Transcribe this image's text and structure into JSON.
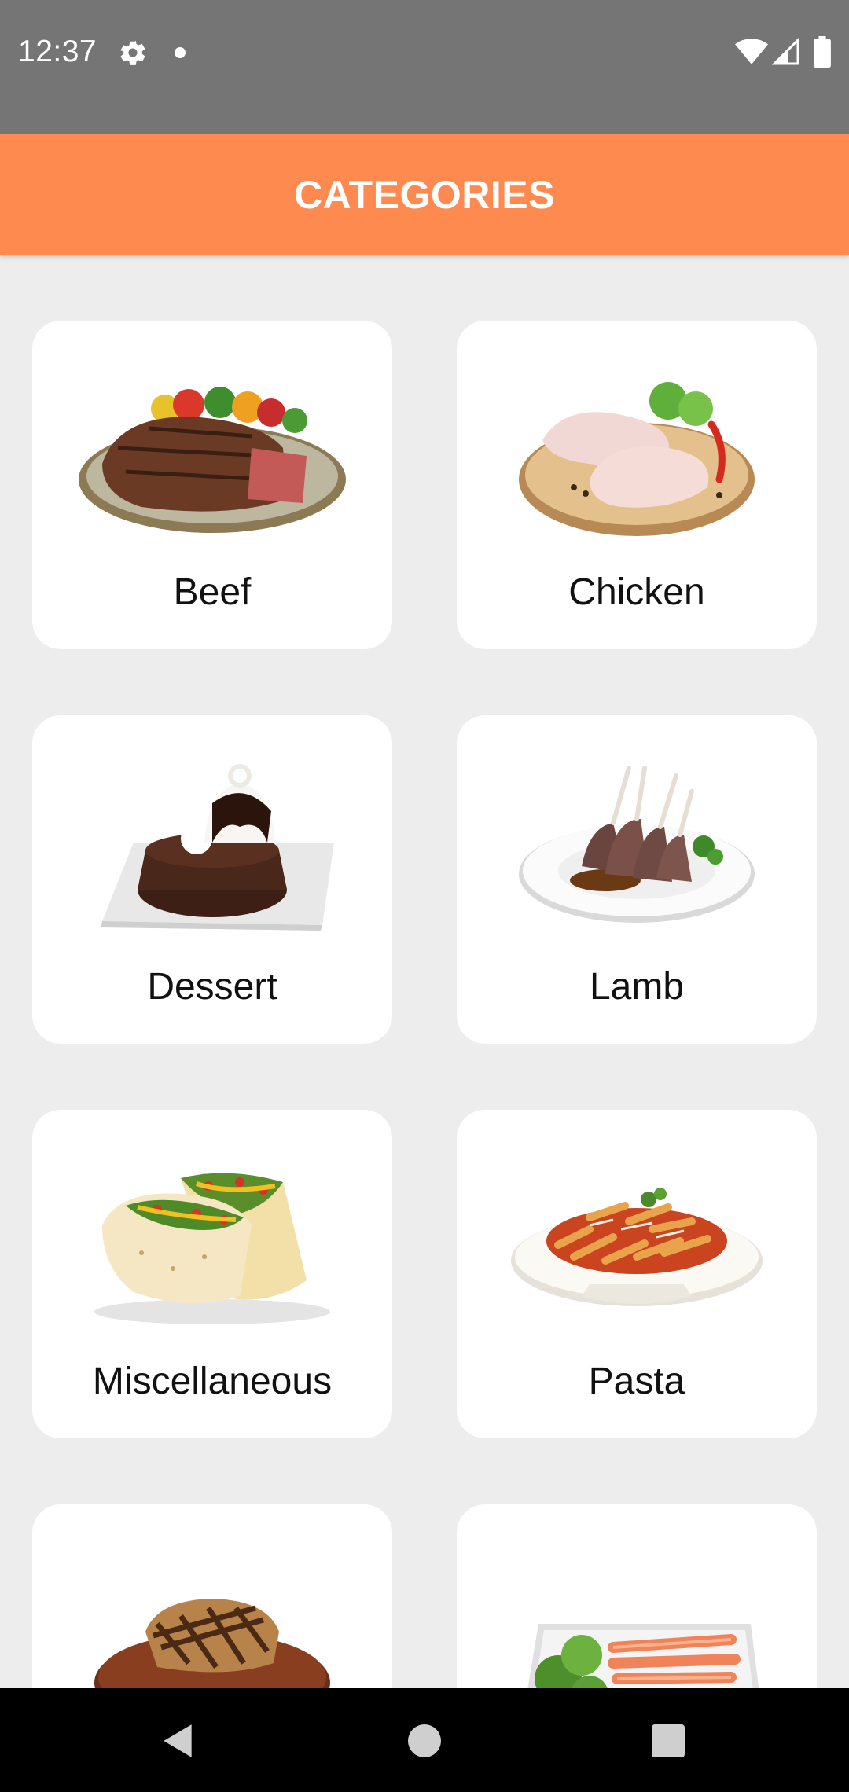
{
  "status_bar": {
    "time": "12:37",
    "icons": [
      "gear-icon",
      "notification-dot-icon",
      "wifi-icon",
      "signal-icon",
      "battery-icon"
    ]
  },
  "app_bar": {
    "title": "CATEGORIES",
    "color": "#FF8A50"
  },
  "categories": [
    {
      "label": "Beef",
      "image": "beef-steak-image"
    },
    {
      "label": "Chicken",
      "image": "raw-chicken-image"
    },
    {
      "label": "Dessert",
      "image": "chocolate-dessert-image"
    },
    {
      "label": "Lamb",
      "image": "lamb-chops-image"
    },
    {
      "label": "Miscellaneous",
      "image": "tacos-image"
    },
    {
      "label": "Pasta",
      "image": "penne-pasta-image"
    },
    {
      "label": "",
      "image": "pork-chop-image"
    },
    {
      "label": "",
      "image": "salmon-salad-image"
    }
  ],
  "nav_bar": {
    "icons": [
      "back-icon",
      "home-icon",
      "recents-icon"
    ]
  }
}
